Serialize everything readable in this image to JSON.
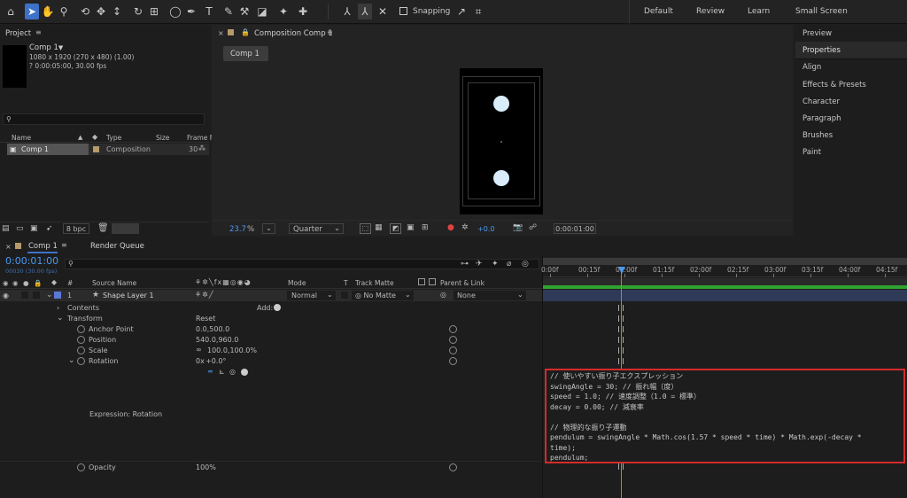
{
  "workspace": {
    "items": [
      "Default",
      "Review",
      "Learn",
      "Small Screen"
    ]
  },
  "toolbar": {
    "snapping_label": "Snapping"
  },
  "project": {
    "panel_title": "Project",
    "comp_name": "Comp 1",
    "comp_info1": "1080 x 1920  (270 x 480) (1.00)",
    "comp_info2": "? 0:00:05:00, 30.00 fps",
    "search_placeholder": "",
    "columns": [
      "Name",
      "Type",
      "Size",
      "Frame F"
    ],
    "rows": [
      {
        "name": "Comp 1",
        "type": "Composition",
        "frame": "30"
      }
    ],
    "bpc": "8 bpc"
  },
  "composition": {
    "panel_title": "Composition Comp 1",
    "tab": "Comp 1",
    "zoom": "23.7",
    "zoom_unit": "%",
    "resolution": "Quarter",
    "exposure": "+0.0",
    "timecode": "0:00:01:00"
  },
  "right_panel": {
    "items": [
      "Preview",
      "Properties",
      "Align",
      "Effects & Presets",
      "Character",
      "Paragraph",
      "Brushes",
      "Paint"
    ]
  },
  "timeline": {
    "tab": "Comp 1",
    "render_tab": "Render Queue",
    "timecode": "0:00:01:00",
    "frames_info": "00030 (30.00 fps)",
    "headers": {
      "num": "#",
      "source": "Source Name",
      "mode": "Mode",
      "t": "T",
      "track_matte": "Track Matte",
      "parent": "Parent & Link"
    },
    "layer": {
      "index": "1",
      "name": "Shape Layer 1",
      "mode": "Normal",
      "matte": "No Matte",
      "parent": "None"
    },
    "contents_label": "Contents",
    "add_label": "Add:",
    "transform_label": "Transform",
    "reset_label": "Reset",
    "props": {
      "anchor": {
        "label": "Anchor Point",
        "value": "0.0,500.0"
      },
      "position": {
        "label": "Position",
        "value": "540.0,960.0"
      },
      "scale": {
        "label": "Scale",
        "value": "100.0,100.0%"
      },
      "rotation": {
        "label": "Rotation",
        "value_a": "0x",
        "value_b": "+0.0°"
      },
      "opacity": {
        "label": "Opacity",
        "value": "100%"
      }
    },
    "expression_label": "Expression: Rotation",
    "ruler": [
      "0:00f",
      "00:15f",
      "01:00f",
      "01:15f",
      "02:00f",
      "02:15f",
      "03:00f",
      "03:15f",
      "04:00f",
      "04:15f"
    ],
    "expression_lines": [
      "// 使いやすい振り子エクスプレッション",
      "swingAngle = 30; // 振れ幅（度）",
      "speed = 1.0; // 速度調整（1.0 = 標準）",
      "decay = 0.00; // 減衰率",
      "",
      "// 物理的な振り子運動",
      "pendulum = swingAngle * Math.cos(1.57 * speed * time) * Math.exp(-decay *",
      "time);",
      "pendulum;"
    ]
  },
  "colors": {
    "accent": "#3d72c8",
    "timecode": "#4a98f0",
    "highlight_box": "#d42b2b",
    "green_bar": "#2fa32f",
    "layer_bar": "#2e3a57"
  }
}
